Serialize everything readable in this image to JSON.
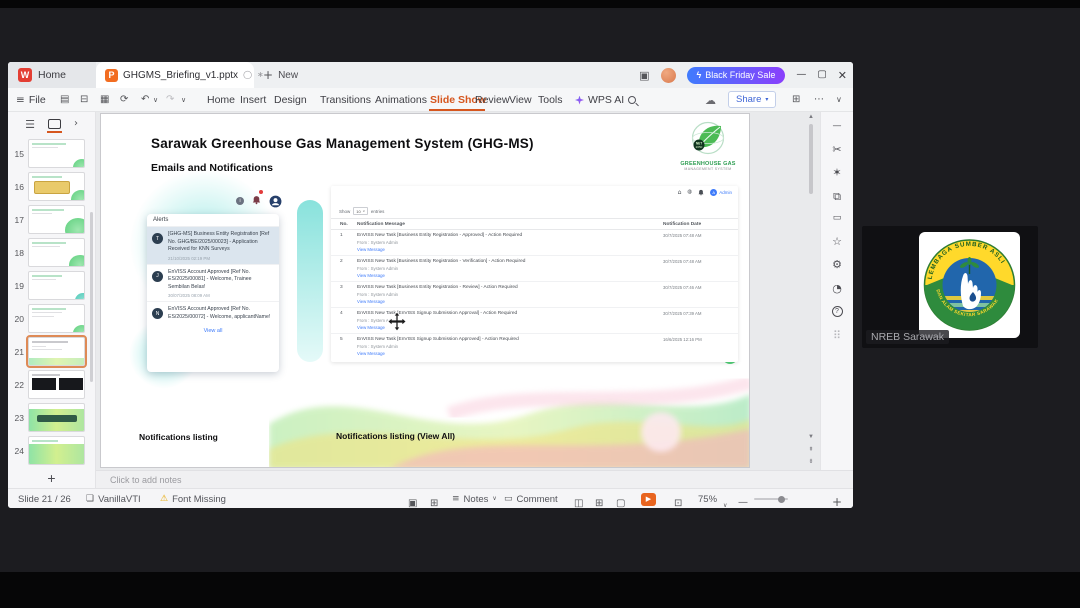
{
  "window": {
    "tab_home": "Home",
    "tab_document": "GHGMS_Briefing_v1.pptx",
    "new_tab": "New",
    "promo_button": "Black Friday Sale",
    "file_menu": "File",
    "menu_items": [
      "Home",
      "Insert",
      "Design",
      "Transitions",
      "Animations",
      "Slide Show",
      "Review",
      "View",
      "Tools",
      "WPS AI"
    ],
    "share_button": "Share"
  },
  "thumbnails": {
    "numbers": [
      "15",
      "16",
      "17",
      "18",
      "19",
      "20",
      "21",
      "22",
      "23",
      "24"
    ],
    "selected": "21"
  },
  "slide": {
    "title": "Sarawak Greenhouse Gas Management System (GHG-MS)",
    "subtitle": "Emails and Notifications",
    "logo": {
      "name_line1": "GREENHOUSE GAS",
      "name_line2": "MANAGEMENT SYSTEM",
      "badge_line1": "NET",
      "badge_line2": "2050"
    },
    "caption_left": "Notifications listing",
    "caption_right": "Notifications listing (View All)",
    "alerts": {
      "title": "Alerts",
      "view_all": "View all",
      "items": [
        {
          "avatar": "T",
          "text": "[GHG-MS] Business Entity Registration [Ref No. GHG/BE/2025/00023] - Application Received for KNN Surveys",
          "date": "21/10/2025 02:19 PM"
        },
        {
          "avatar": "J",
          "text": "EnVISS Account Approved [Ref No. ES/2025/00081] - Welcome, Trainee Sembilan Belas!",
          "date": "30/07/2025 08:09 AM"
        },
        {
          "avatar": "N",
          "text": "EnVISS Account Approved [Ref No. ES/2025/00072] - Welcome, applicantName!",
          "date": ""
        }
      ]
    },
    "portal": {
      "user_name": "Admin",
      "show_label": "Show",
      "show_value": "10",
      "entries_label": "entries",
      "col_no": "No.",
      "col_message": "Notification Message",
      "col_date": "Notification Date",
      "from_label": "From : System Admin",
      "view_message": "View Message",
      "rows": [
        {
          "no": "1",
          "message": "EnVISS New Task [Business Entity Registration - Approved] - Action Required",
          "date": "30/7/2025 07:48 AM"
        },
        {
          "no": "2",
          "message": "EnVISS New Task [Business Entity Registration - Verification] - Action Required",
          "date": "30/7/2025 07:48 AM"
        },
        {
          "no": "3",
          "message": "EnVISS New Task [Business Entity Registration - Review] - Action Required",
          "date": "30/7/2025 07:46 AM"
        },
        {
          "no": "4",
          "message": "EnVISS New Task [EnVISS Signup Submission Approval] - Action Required",
          "date": "30/7/2025 07:39 AM"
        },
        {
          "no": "5",
          "message": "EnVISS New Task [EnVISS Signup Submission Approved] - Action Required",
          "date": "16/6/2025 12:16 PM"
        }
      ]
    }
  },
  "notes": {
    "placeholder": "Click to add notes"
  },
  "statusbar": {
    "slide_indicator": "Slide 21 / 26",
    "theme_name": "VanillaVTI",
    "font_missing": "Font Missing",
    "notes_label": "Notes",
    "comment_label": "Comment",
    "zoom_level": "75%"
  },
  "meeting": {
    "participant_name": "NREB Sarawak",
    "logo_text_top": "LEMBAGA SUMBER ASLI",
    "logo_text_bottom": "DAN ALAM SEKITAR SARAWAK"
  },
  "colors": {
    "accent_orange": "#d6561e",
    "promo_start": "#3f7bfd",
    "promo_end": "#8a3ffc",
    "link_blue": "#3e7bfa",
    "alert_highlight": "#dbe5ee"
  }
}
